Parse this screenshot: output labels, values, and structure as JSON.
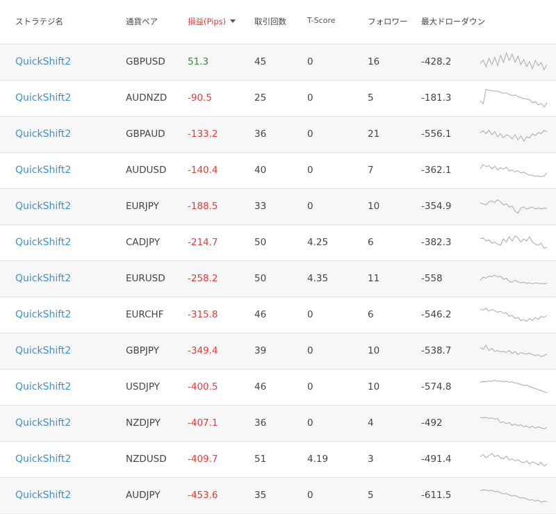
{
  "header": {
    "strategy": "ストラテジ名",
    "pair": "通貨ペア",
    "pnl": "損益(Pips)",
    "trades": "取引回数",
    "tscore": "T-Score",
    "followers": "フォロワー",
    "max_drawdown": "最大ドローダウン"
  },
  "colors": {
    "link": "#3a8fd8",
    "positive": "#2e8b3a",
    "negative": "#e53935",
    "sparkline": "#a9a9a9"
  },
  "rows": [
    {
      "name": "QuickShift2",
      "pair": "GBPUSD",
      "pnl": "51.3",
      "trades": "45",
      "tscore": "0",
      "followers": "16",
      "dd": "-428.2",
      "spark": [
        0.45,
        0.62,
        0.3,
        0.7,
        0.4,
        0.75,
        0.35,
        0.85,
        0.5,
        0.95,
        0.6,
        0.9,
        0.5,
        0.8,
        0.4,
        0.65,
        0.3,
        0.55,
        0.2,
        0.6,
        0.35,
        0.5,
        0.15,
        0.4
      ]
    },
    {
      "name": "QuickShift2",
      "pair": "AUDNZD",
      "pnl": "-90.5",
      "trades": "25",
      "tscore": "0",
      "followers": "5",
      "dd": "-181.3",
      "spark": [
        0.4,
        0.25,
        0.95,
        0.9,
        0.88,
        0.85,
        0.87,
        0.8,
        0.75,
        0.78,
        0.7,
        0.65,
        0.68,
        0.6,
        0.55,
        0.5,
        0.48,
        0.45,
        0.3,
        0.35,
        0.2,
        0.28,
        0.1,
        0.3
      ]
    },
    {
      "name": "QuickShift2",
      "pair": "GBPAUD",
      "pnl": "-133.2",
      "trades": "36",
      "tscore": "0",
      "followers": "21",
      "dd": "-556.1",
      "spark": [
        0.6,
        0.7,
        0.55,
        0.72,
        0.5,
        0.65,
        0.4,
        0.55,
        0.35,
        0.5,
        0.45,
        0.3,
        0.5,
        0.25,
        0.45,
        0.2,
        0.4,
        0.35,
        0.55,
        0.45,
        0.6,
        0.55,
        0.7,
        0.65
      ]
    },
    {
      "name": "QuickShift2",
      "pair": "AUDUSD",
      "pnl": "-140.4",
      "trades": "40",
      "tscore": "0",
      "followers": "7",
      "dd": "-362.1",
      "spark": [
        0.6,
        0.8,
        0.7,
        0.75,
        0.6,
        0.72,
        0.55,
        0.65,
        0.58,
        0.68,
        0.5,
        0.55,
        0.45,
        0.5,
        0.4,
        0.45,
        0.35,
        0.3,
        0.28,
        0.25,
        0.25,
        0.22,
        0.25,
        0.4
      ]
    },
    {
      "name": "QuickShift2",
      "pair": "EURJPY",
      "pnl": "-188.5",
      "trades": "33",
      "tscore": "0",
      "followers": "10",
      "dd": "-354.9",
      "spark": [
        0.7,
        0.65,
        0.6,
        0.75,
        0.8,
        0.7,
        0.85,
        0.75,
        0.6,
        0.65,
        0.5,
        0.55,
        0.3,
        0.2,
        0.45,
        0.5,
        0.4,
        0.45,
        0.5,
        0.4,
        0.45,
        0.4,
        0.45,
        0.42
      ]
    },
    {
      "name": "QuickShift2",
      "pair": "CADJPY",
      "pnl": "-214.7",
      "trades": "50",
      "tscore": "4.25",
      "followers": "6",
      "dd": "-382.3",
      "spark": [
        0.7,
        0.75,
        0.6,
        0.65,
        0.5,
        0.55,
        0.45,
        0.4,
        0.7,
        0.55,
        0.8,
        0.6,
        0.85,
        0.75,
        0.55,
        0.7,
        0.6,
        0.8,
        0.55,
        0.45,
        0.4,
        0.5,
        0.25,
        0.3
      ]
    },
    {
      "name": "QuickShift2",
      "pair": "EURUSD",
      "pnl": "-258.2",
      "trades": "50",
      "tscore": "4.35",
      "followers": "11",
      "dd": "-558",
      "spark": [
        0.45,
        0.6,
        0.55,
        0.65,
        0.62,
        0.7,
        0.6,
        0.65,
        0.5,
        0.55,
        0.4,
        0.35,
        0.45,
        0.38,
        0.32,
        0.36,
        0.3,
        0.33,
        0.28,
        0.32,
        0.3,
        0.3,
        0.28,
        0.3
      ]
    },
    {
      "name": "QuickShift2",
      "pair": "EURCHF",
      "pnl": "-315.8",
      "trades": "46",
      "tscore": "0",
      "followers": "6",
      "dd": "-546.2",
      "spark": [
        0.8,
        0.75,
        0.85,
        0.7,
        0.78,
        0.72,
        0.65,
        0.7,
        0.6,
        0.62,
        0.45,
        0.5,
        0.35,
        0.4,
        0.25,
        0.3,
        0.2,
        0.35,
        0.25,
        0.4,
        0.3,
        0.45,
        0.4,
        0.5
      ]
    },
    {
      "name": "QuickShift2",
      "pair": "GBPJPY",
      "pnl": "-349.4",
      "trades": "39",
      "tscore": "0",
      "followers": "10",
      "dd": "-538.7",
      "spark": [
        0.7,
        0.6,
        0.8,
        0.55,
        0.65,
        0.5,
        0.55,
        0.48,
        0.5,
        0.45,
        0.55,
        0.4,
        0.5,
        0.35,
        0.45,
        0.4,
        0.38,
        0.42,
        0.35,
        0.3,
        0.35,
        0.25,
        0.3,
        0.38
      ]
    },
    {
      "name": "QuickShift2",
      "pair": "USDJPY",
      "pnl": "-400.5",
      "trades": "46",
      "tscore": "0",
      "followers": "10",
      "dd": "-574.8",
      "spark": [
        0.75,
        0.8,
        0.78,
        0.82,
        0.8,
        0.85,
        0.8,
        0.82,
        0.78,
        0.8,
        0.75,
        0.78,
        0.72,
        0.7,
        0.65,
        0.6,
        0.62,
        0.55,
        0.5,
        0.45,
        0.4,
        0.35,
        0.3,
        0.25
      ]
    },
    {
      "name": "QuickShift2",
      "pair": "NZDJPY",
      "pnl": "-407.1",
      "trades": "36",
      "tscore": "0",
      "followers": "4",
      "dd": "-492",
      "spark": [
        0.8,
        0.78,
        0.8,
        0.75,
        0.78,
        0.72,
        0.74,
        0.55,
        0.6,
        0.5,
        0.55,
        0.42,
        0.48,
        0.4,
        0.45,
        0.35,
        0.4,
        0.3,
        0.38,
        0.28,
        0.35,
        0.3,
        0.25,
        0.32
      ]
    },
    {
      "name": "QuickShift2",
      "pair": "NZDUSD",
      "pnl": "-409.7",
      "trades": "51",
      "tscore": "4.19",
      "followers": "3",
      "dd": "-491.4",
      "spark": [
        0.65,
        0.75,
        0.6,
        0.7,
        0.8,
        0.65,
        0.72,
        0.6,
        0.55,
        0.68,
        0.5,
        0.55,
        0.45,
        0.5,
        0.4,
        0.35,
        0.45,
        0.3,
        0.4,
        0.35,
        0.25,
        0.38,
        0.2,
        0.3
      ]
    },
    {
      "name": "QuickShift2",
      "pair": "AUDJPY",
      "pnl": "-453.6",
      "trades": "35",
      "tscore": "0",
      "followers": "5",
      "dd": "-611.5",
      "spark": [
        0.75,
        0.8,
        0.78,
        0.75,
        0.78,
        0.7,
        0.72,
        0.65,
        0.6,
        0.62,
        0.55,
        0.5,
        0.52,
        0.45,
        0.4,
        0.42,
        0.35,
        0.3,
        0.32,
        0.25,
        0.3,
        0.2,
        0.25,
        0.22
      ]
    }
  ]
}
